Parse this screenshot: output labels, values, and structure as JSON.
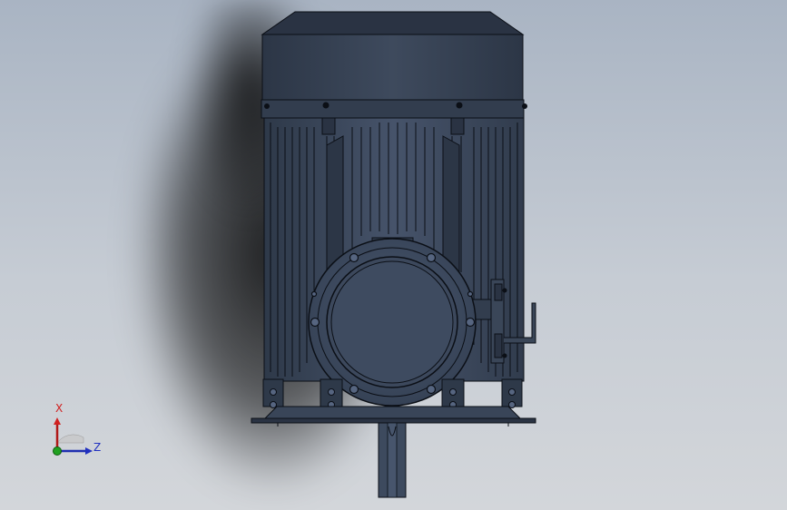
{
  "viewport": {
    "background_top": "#a9b4c3",
    "background_bottom": "#d3d6da"
  },
  "model": {
    "description_icon": "electric-motor-icon",
    "body_color": "#3a4658",
    "edge_color": "#0b0f16"
  },
  "triad": {
    "x_label": "X",
    "z_label": "Z",
    "x_color": "#d02020",
    "y_color": "#20a020",
    "z_color": "#2030c0"
  }
}
